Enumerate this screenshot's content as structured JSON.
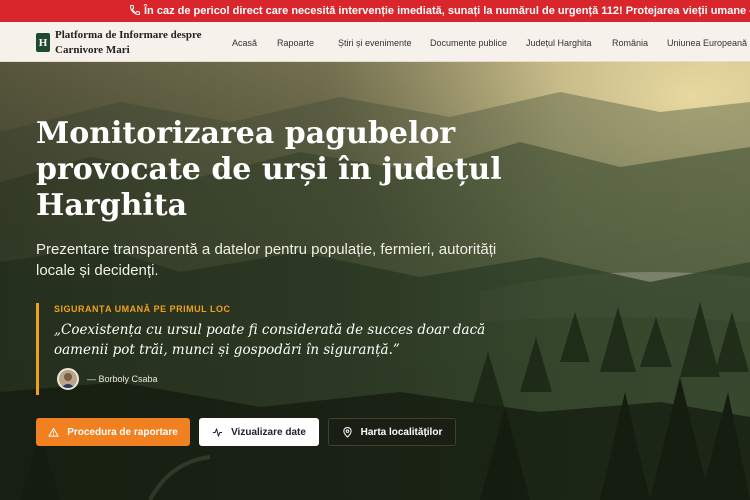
{
  "alert": {
    "icon": "phone-icon",
    "text": "În caz de pericol direct care necesită intervenție imediată, sunați la numărul de urgență 112! Protejarea vieții umane este cea mai importantă."
  },
  "brand": {
    "badge": "H",
    "name": "Platforma de Informare despre Carnivore Mari"
  },
  "nav": {
    "items": [
      {
        "label": "Acasă"
      },
      {
        "label": "Rapoarte"
      },
      {
        "label": "Știri și evenimente"
      },
      {
        "label": "Documente publice"
      },
      {
        "label": "Județul Harghita"
      },
      {
        "label": "România"
      },
      {
        "label": "Uniunea Europeană"
      }
    ]
  },
  "hero": {
    "title": "Monitorizarea pagubelor provocate de urși în județul Harghita",
    "subtitle": "Prezentare transparentă a datelor pentru populație, fermieri, autorități locale și decidenți.",
    "quote_kicker": "SIGURANȚA UMANĂ PE PRIMUL LOC",
    "quote": "„Coexistența cu ursul poate fi considerată de succes doar dacă oamenii pot trăi, munci și gospodări în siguranță.”",
    "author": "— Borboly Csaba"
  },
  "buttons": {
    "report": {
      "label": "Procedura de raportare",
      "icon": "warning-icon"
    },
    "data": {
      "label": "Vizualizare date",
      "icon": "activity-icon"
    },
    "map": {
      "label": "Harta localităților",
      "icon": "map-pin-icon"
    }
  },
  "colors": {
    "alert_red": "#d8262c",
    "accent_orange": "#f08020",
    "brand_green": "#1f4a2f"
  }
}
